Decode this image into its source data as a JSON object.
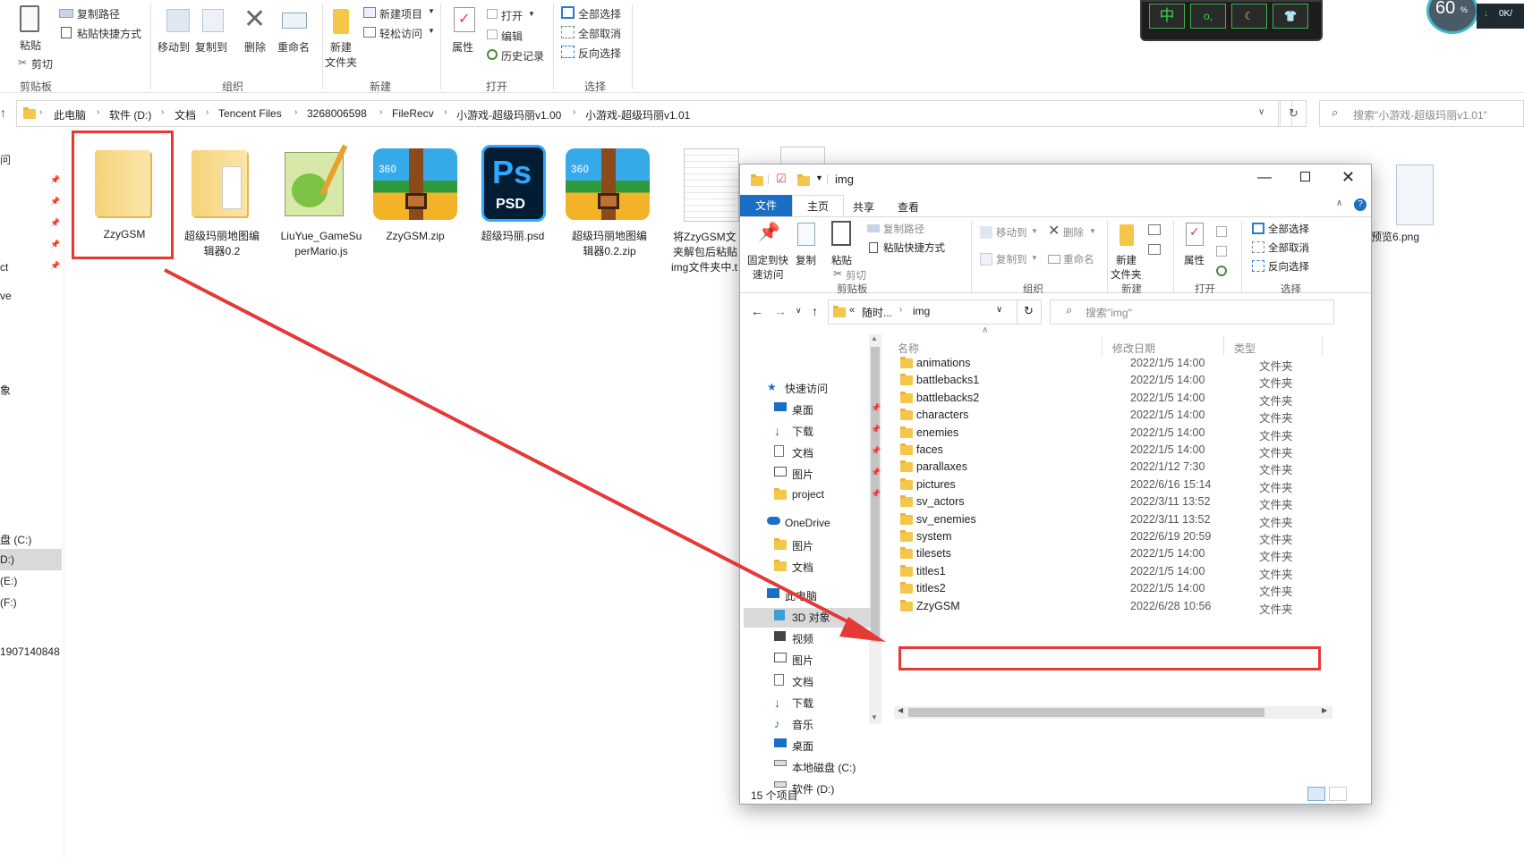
{
  "bg_ribbon": {
    "clipboard": {
      "copy_path": "复制路径",
      "paste_shortcut": "粘贴快捷方式",
      "paste": "粘贴",
      "cut": "剪切",
      "group": "剪贴板"
    },
    "organize": {
      "move_to": "移动到",
      "copy_to": "复制到",
      "delete": "删除",
      "rename": "重命名",
      "group": "组织"
    },
    "new": {
      "new_item": "新建项目",
      "easy_access": "轻松访问",
      "new_folder": "新建\n文件夹",
      "new_folder_1": "新建",
      "new_folder_2": "文件夹",
      "group": "新建"
    },
    "open": {
      "open": "打开",
      "edit": "编辑",
      "history": "历史记录",
      "properties": "属性",
      "group": "打开"
    },
    "select": {
      "select_all": "全部选择",
      "select_none": "全部取消",
      "invert": "反向选择",
      "group": "选择"
    }
  },
  "bg_address": {
    "crumbs": [
      "此电脑",
      "软件 (D:)",
      "文档",
      "Tencent Files",
      "3268006598",
      "FileRecv",
      "小游戏-超级玛丽v1.00",
      "小游戏-超级玛丽v1.01"
    ],
    "search_placeholder": "搜索\"小游戏-超级玛丽v1.01\""
  },
  "bg_nav_partial": [
    "问",
    "ct",
    "ve",
    "象",
    "盘 (C:)",
    "D:)",
    "(E:)",
    "(F:)",
    "1907140848"
  ],
  "bg_files": [
    {
      "name": "ZzyGSM",
      "icon": "folder-icon"
    },
    {
      "name": "超级玛丽地图编辑器0.2",
      "icon": "folder-icon"
    },
    {
      "name": "LiuYue_GameSuperMario.js",
      "icon": "notepadpp-icon"
    },
    {
      "name": "ZzyGSM.zip",
      "icon": "zip-archive-icon"
    },
    {
      "name": "超级玛丽.psd",
      "icon": "photoshop-icon"
    },
    {
      "name": "超级玛丽地图编辑器0.2.zip",
      "icon": "zip-archive-icon"
    },
    {
      "name": "将ZzyGSM文件夹解包后粘贴到img文件夹中.t",
      "icon": "text-file-icon"
    },
    {
      "name": "预览6.png",
      "icon": "image-file-icon"
    }
  ],
  "bg_file_caps": {
    "f0": "ZzyGSM",
    "f1a": "超级玛丽地图编",
    "f1b": "辑器0.2",
    "f2a": "LiuYue_GameSu",
    "f2b": "perMario.js",
    "f3": "ZzyGSM.zip",
    "f4": "超级玛丽.psd",
    "f5a": "超级玛丽地图编",
    "f5b": "辑器0.2.zip",
    "f6a": "将ZzyGSM文",
    "f6b": "夹解包后粘贴",
    "f6c": "img文件夹中.t",
    "f7": "预览6.png"
  },
  "widget": {
    "ime": "中",
    "percent": "60",
    "percent_sign": "%",
    "speed": "0K/"
  },
  "win": {
    "title": "img",
    "tabs": [
      "文件",
      "主页",
      "共享",
      "查看"
    ],
    "ribbon": {
      "pin": "固定到快",
      "pin2": "速访问",
      "copy": "复制",
      "paste": "粘贴",
      "copy_path": "复制路径",
      "paste_shortcut": "粘贴快捷方式",
      "cut": "剪切",
      "move_to": "移动到",
      "copy_to": "复制到",
      "delete": "删除",
      "rename": "重命名",
      "new_folder_1": "新建",
      "new_folder_2": "文件夹",
      "properties": "属性",
      "select_all": "全部选择",
      "select_none": "全部取消",
      "invert": "反向选择",
      "groups": [
        "剪贴板",
        "组织",
        "新建",
        "打开",
        "选择"
      ]
    },
    "address": {
      "ellipsis": "«",
      "crumb1": "随时...",
      "crumb2": "img"
    },
    "search_placeholder": "搜索\"img\"",
    "nav": [
      {
        "label": "快速访问",
        "icon": "star-icon",
        "pin": false
      },
      {
        "label": "桌面",
        "icon": "desktop-icon",
        "pin": true
      },
      {
        "label": "下载",
        "icon": "download-icon",
        "pin": true
      },
      {
        "label": "文档",
        "icon": "document-icon",
        "pin": true
      },
      {
        "label": "图片",
        "icon": "picture-icon",
        "pin": true
      },
      {
        "label": "project",
        "icon": "folder-icon",
        "pin": true
      },
      {
        "label": "OneDrive",
        "icon": "cloud-icon",
        "pin": false
      },
      {
        "label": "图片",
        "icon": "folder-icon",
        "pin": false
      },
      {
        "label": "文档",
        "icon": "folder-icon",
        "pin": false
      },
      {
        "label": "此电脑",
        "icon": "computer-icon",
        "pin": false
      },
      {
        "label": "3D 对象",
        "icon": "cube-icon",
        "pin": false
      },
      {
        "label": "视频",
        "icon": "video-icon",
        "pin": false
      },
      {
        "label": "图片",
        "icon": "picture-icon",
        "pin": false
      },
      {
        "label": "文档",
        "icon": "document-icon",
        "pin": false
      },
      {
        "label": "下载",
        "icon": "download-icon",
        "pin": false
      },
      {
        "label": "音乐",
        "icon": "music-icon",
        "pin": false
      },
      {
        "label": "桌面",
        "icon": "desktop-icon",
        "pin": false
      },
      {
        "label": "本地磁盘 (C:)",
        "icon": "drive-icon",
        "pin": false
      },
      {
        "label": "软件 (D:)",
        "icon": "drive-icon",
        "pin": false
      }
    ],
    "columns": [
      "名称",
      "修改日期",
      "类型"
    ],
    "rows": [
      [
        "animations",
        "2022/1/5 14:00",
        "文件夹"
      ],
      [
        "battlebacks1",
        "2022/1/5 14:00",
        "文件夹"
      ],
      [
        "battlebacks2",
        "2022/1/5 14:00",
        "文件夹"
      ],
      [
        "characters",
        "2022/1/5 14:00",
        "文件夹"
      ],
      [
        "enemies",
        "2022/1/5 14:00",
        "文件夹"
      ],
      [
        "faces",
        "2022/1/5 14:00",
        "文件夹"
      ],
      [
        "parallaxes",
        "2022/1/12 7:30",
        "文件夹"
      ],
      [
        "pictures",
        "2022/6/16 15:14",
        "文件夹"
      ],
      [
        "sv_actors",
        "2022/3/11 13:52",
        "文件夹"
      ],
      [
        "sv_enemies",
        "2022/3/11 13:52",
        "文件夹"
      ],
      [
        "system",
        "2022/6/19 20:59",
        "文件夹"
      ],
      [
        "tilesets",
        "2022/1/5 14:00",
        "文件夹"
      ],
      [
        "titles1",
        "2022/1/5 14:00",
        "文件夹"
      ],
      [
        "titles2",
        "2022/1/5 14:00",
        "文件夹"
      ],
      [
        "ZzyGSM",
        "2022/6/28 10:56",
        "文件夹"
      ]
    ],
    "status": "15 个项目"
  },
  "colors": {
    "highlight": "#e53935",
    "accent": "#0063b1",
    "folder": "#f4c64a"
  }
}
